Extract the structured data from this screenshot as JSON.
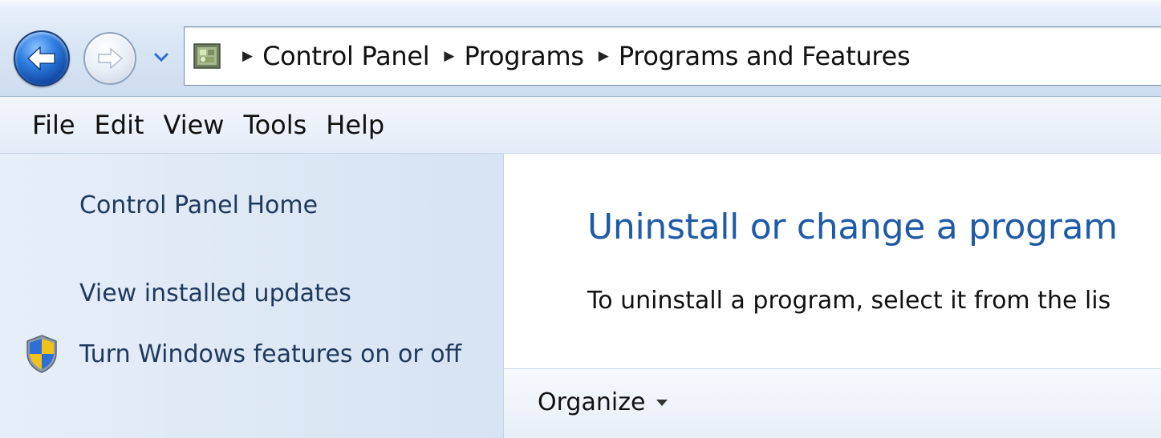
{
  "address_bar": {
    "breadcrumbs": [
      "Control Panel",
      "Programs",
      "Programs and Features"
    ]
  },
  "menubar": {
    "items": [
      "File",
      "Edit",
      "View",
      "Tools",
      "Help"
    ]
  },
  "left_pane": {
    "links": {
      "home": "Control Panel Home",
      "updates": "View installed updates",
      "features": "Turn Windows features on or off"
    }
  },
  "main": {
    "title": "Uninstall or change a program",
    "description": "To uninstall a program, select it from the lis",
    "command_bar": {
      "organize_label": "Organize"
    }
  },
  "icons": {
    "back": "back-arrow-icon",
    "forward": "forward-arrow-icon",
    "recent": "chevron-down-icon",
    "location": "control-panel-icon",
    "breadcrumb_separator": "triangle-right-icon",
    "uac": "uac-shield-icon"
  },
  "colors": {
    "link": "#1e395b",
    "title": "#1e5aa8",
    "nav_back": "#2f7ee0"
  }
}
